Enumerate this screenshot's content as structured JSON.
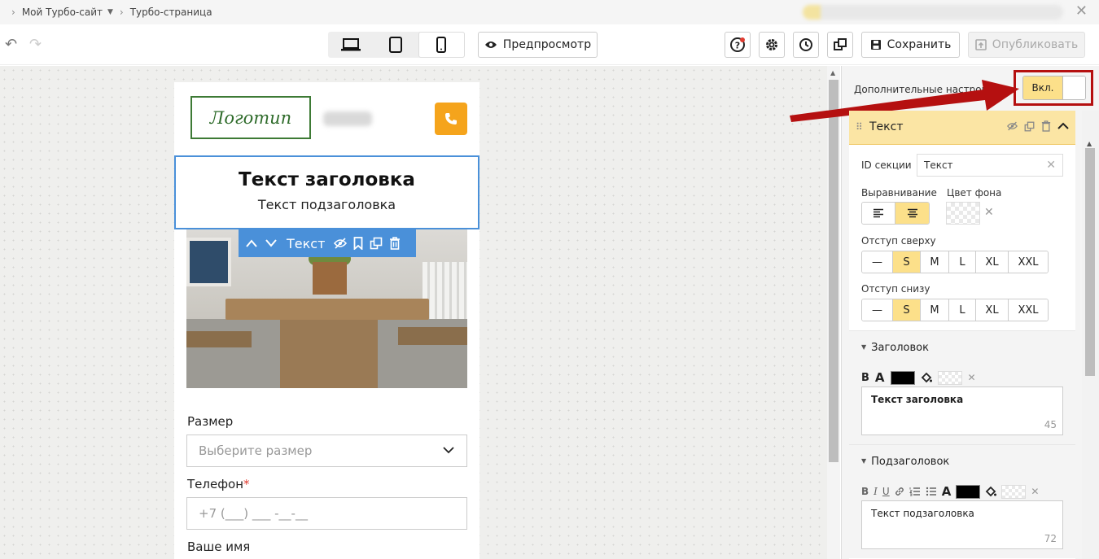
{
  "breadcrumbs": {
    "site": "Мой Турбо-сайт",
    "page": "Турбо-страница"
  },
  "toolbar": {
    "preview_label": "Предпросмотр",
    "save_label": "Сохранить",
    "publish_label": "Опубликовать"
  },
  "page": {
    "logo_text": "Логотип",
    "title": "Текст заголовка",
    "subtitle": "Текст подзаголовка",
    "section_toolbar_label": "Текст",
    "form": {
      "size_label": "Размер",
      "size_placeholder": "Выберите размер",
      "phone_label": "Телефон",
      "phone_required_mark": "*",
      "phone_placeholder": "+7 (___) ___ -__-__",
      "name_label": "Ваше имя"
    }
  },
  "panel": {
    "advanced_label": "Дополнительные настройки",
    "toggle_label": "Вкл.",
    "section_title": "Текст",
    "section_id_label": "ID секции",
    "section_id_value": "Текст",
    "align_label": "Выравнивание",
    "bg_color_label": "Цвет фона",
    "padding_top_label": "Отступ сверху",
    "padding_bottom_label": "Отступ снизу",
    "sizes": [
      "—",
      "S",
      "M",
      "L",
      "XL",
      "XXL"
    ],
    "selected_size": "S",
    "heading": {
      "title": "Заголовок",
      "text": "Текст заголовка",
      "remaining": "45"
    },
    "subheading": {
      "title": "Подзаголовок",
      "text": "Текст подзаголовка",
      "remaining": "72"
    }
  },
  "colors": {
    "accent_blue": "#4a90d9",
    "accent_yellow": "#fce08a",
    "phone_orange": "#f5a41c",
    "annotation_red": "#b51010",
    "logo_green": "#3d7a35"
  }
}
